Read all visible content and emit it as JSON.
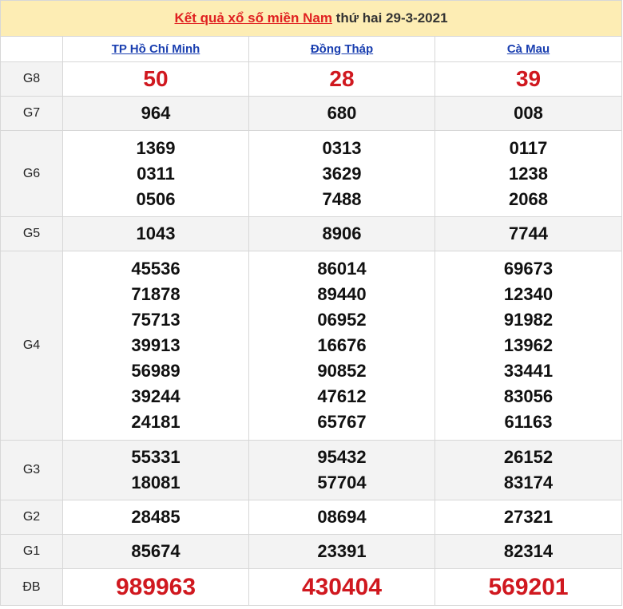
{
  "title": {
    "link_text": "Kết quả xổ số miền Nam",
    "rest_text": "thứ hai 29-3-2021"
  },
  "provinces": [
    "TP Hồ Chí Minh",
    "Đồng Tháp",
    "Cà Mau"
  ],
  "prizes": [
    {
      "label": "G8",
      "values": [
        [
          "50"
        ],
        [
          "28"
        ],
        [
          "39"
        ]
      ]
    },
    {
      "label": "G7",
      "values": [
        [
          "964"
        ],
        [
          "680"
        ],
        [
          "008"
        ]
      ]
    },
    {
      "label": "G6",
      "values": [
        [
          "1369",
          "0311",
          "0506"
        ],
        [
          "0313",
          "3629",
          "7488"
        ],
        [
          "0117",
          "1238",
          "2068"
        ]
      ]
    },
    {
      "label": "G5",
      "values": [
        [
          "1043"
        ],
        [
          "8906"
        ],
        [
          "7744"
        ]
      ]
    },
    {
      "label": "G4",
      "values": [
        [
          "45536",
          "71878",
          "75713",
          "39913",
          "56989",
          "39244",
          "24181"
        ],
        [
          "86014",
          "89440",
          "06952",
          "16676",
          "90852",
          "47612",
          "65767"
        ],
        [
          "69673",
          "12340",
          "91982",
          "13962",
          "33441",
          "83056",
          "61163"
        ]
      ]
    },
    {
      "label": "G3",
      "values": [
        [
          "55331",
          "18081"
        ],
        [
          "95432",
          "57704"
        ],
        [
          "26152",
          "83174"
        ]
      ]
    },
    {
      "label": "G2",
      "values": [
        [
          "28485"
        ],
        [
          "08694"
        ],
        [
          "27321"
        ]
      ]
    },
    {
      "label": "G1",
      "values": [
        [
          "85674"
        ],
        [
          "23391"
        ],
        [
          "82314"
        ]
      ]
    },
    {
      "label": "ĐB",
      "values": [
        [
          "989963"
        ],
        [
          "430404"
        ],
        [
          "569201"
        ]
      ]
    }
  ],
  "colors": {
    "header_bg": "#fdedb4",
    "accent_red": "#d0181f",
    "province_blue": "#1a3fb0"
  }
}
